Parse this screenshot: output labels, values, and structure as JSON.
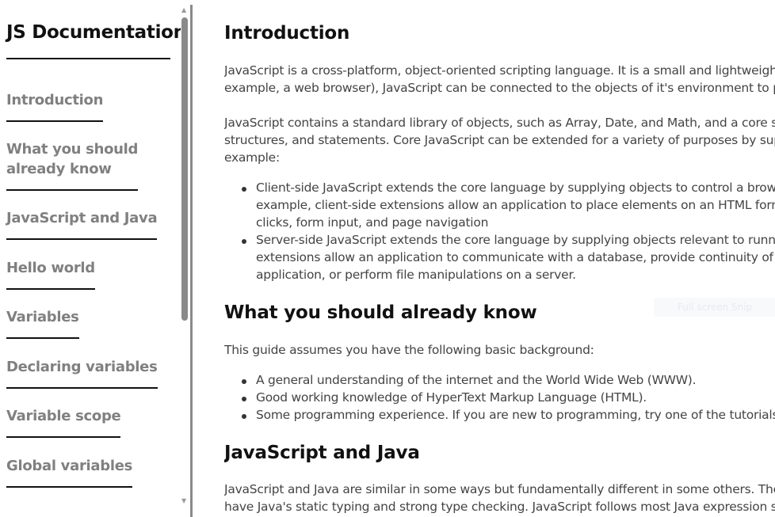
{
  "sidebar": {
    "title": "JS Documentation",
    "items": [
      {
        "label": "Introduction"
      },
      {
        "label": "What you should already know",
        "lines": [
          "What you should",
          "already know"
        ]
      },
      {
        "label": "JavaScript and Java"
      },
      {
        "label": "Hello world"
      },
      {
        "label": "Variables"
      },
      {
        "label": "Declaring variables"
      },
      {
        "label": "Variable scope"
      },
      {
        "label": "Global variables"
      }
    ]
  },
  "main": {
    "sections": [
      {
        "heading": "Introduction",
        "paragraphs": [
          [
            "JavaScript is a cross-platform, object-oriented scripting language. It is a small and lightweight l",
            "example, a web browser), JavaScript can be connected to the objects of it's environment to pro"
          ],
          [
            "JavaScript contains a standard library of objects, such as Array, Date, and Math, and a core set",
            "structures, and statements. Core JavaScript can be extended for a variety of purposes by supp",
            "example:"
          ]
        ],
        "bullets": [
          [
            "Client-side JavaScript extends the core language by supplying objects to control a browse",
            "example, client-side extensions allow an application to place elements on an HTML form",
            "clicks, form input, and page navigation"
          ],
          [
            "Server-side JavaScript extends the core language by supplying objects relevant to running",
            "extensions allow an application to communicate with a database, provide continuity of in",
            "application, or perform file manipulations on a server."
          ]
        ]
      },
      {
        "heading": "What you should already know",
        "paragraphs": [
          [
            "This guide assumes you have the following basic background:"
          ]
        ],
        "bullets": [
          [
            "A general understanding of the internet and the World Wide Web (WWW)."
          ],
          [
            "Good working knowledge of HyperText Markup Language (HTML)."
          ],
          [
            "Some programming experience. If you are new to programming, try one of the tutorials l"
          ]
        ]
      },
      {
        "heading": "JavaScript and Java",
        "paragraphs": [
          [
            "JavaScript and Java are similar in some ways but fundamentally different in some others. The J",
            "have Java's static typing and strong type checking. JavaScript follows most Java expression synt"
          ]
        ]
      }
    ]
  },
  "overlay": {
    "snip_label": "Full screen Snip"
  }
}
